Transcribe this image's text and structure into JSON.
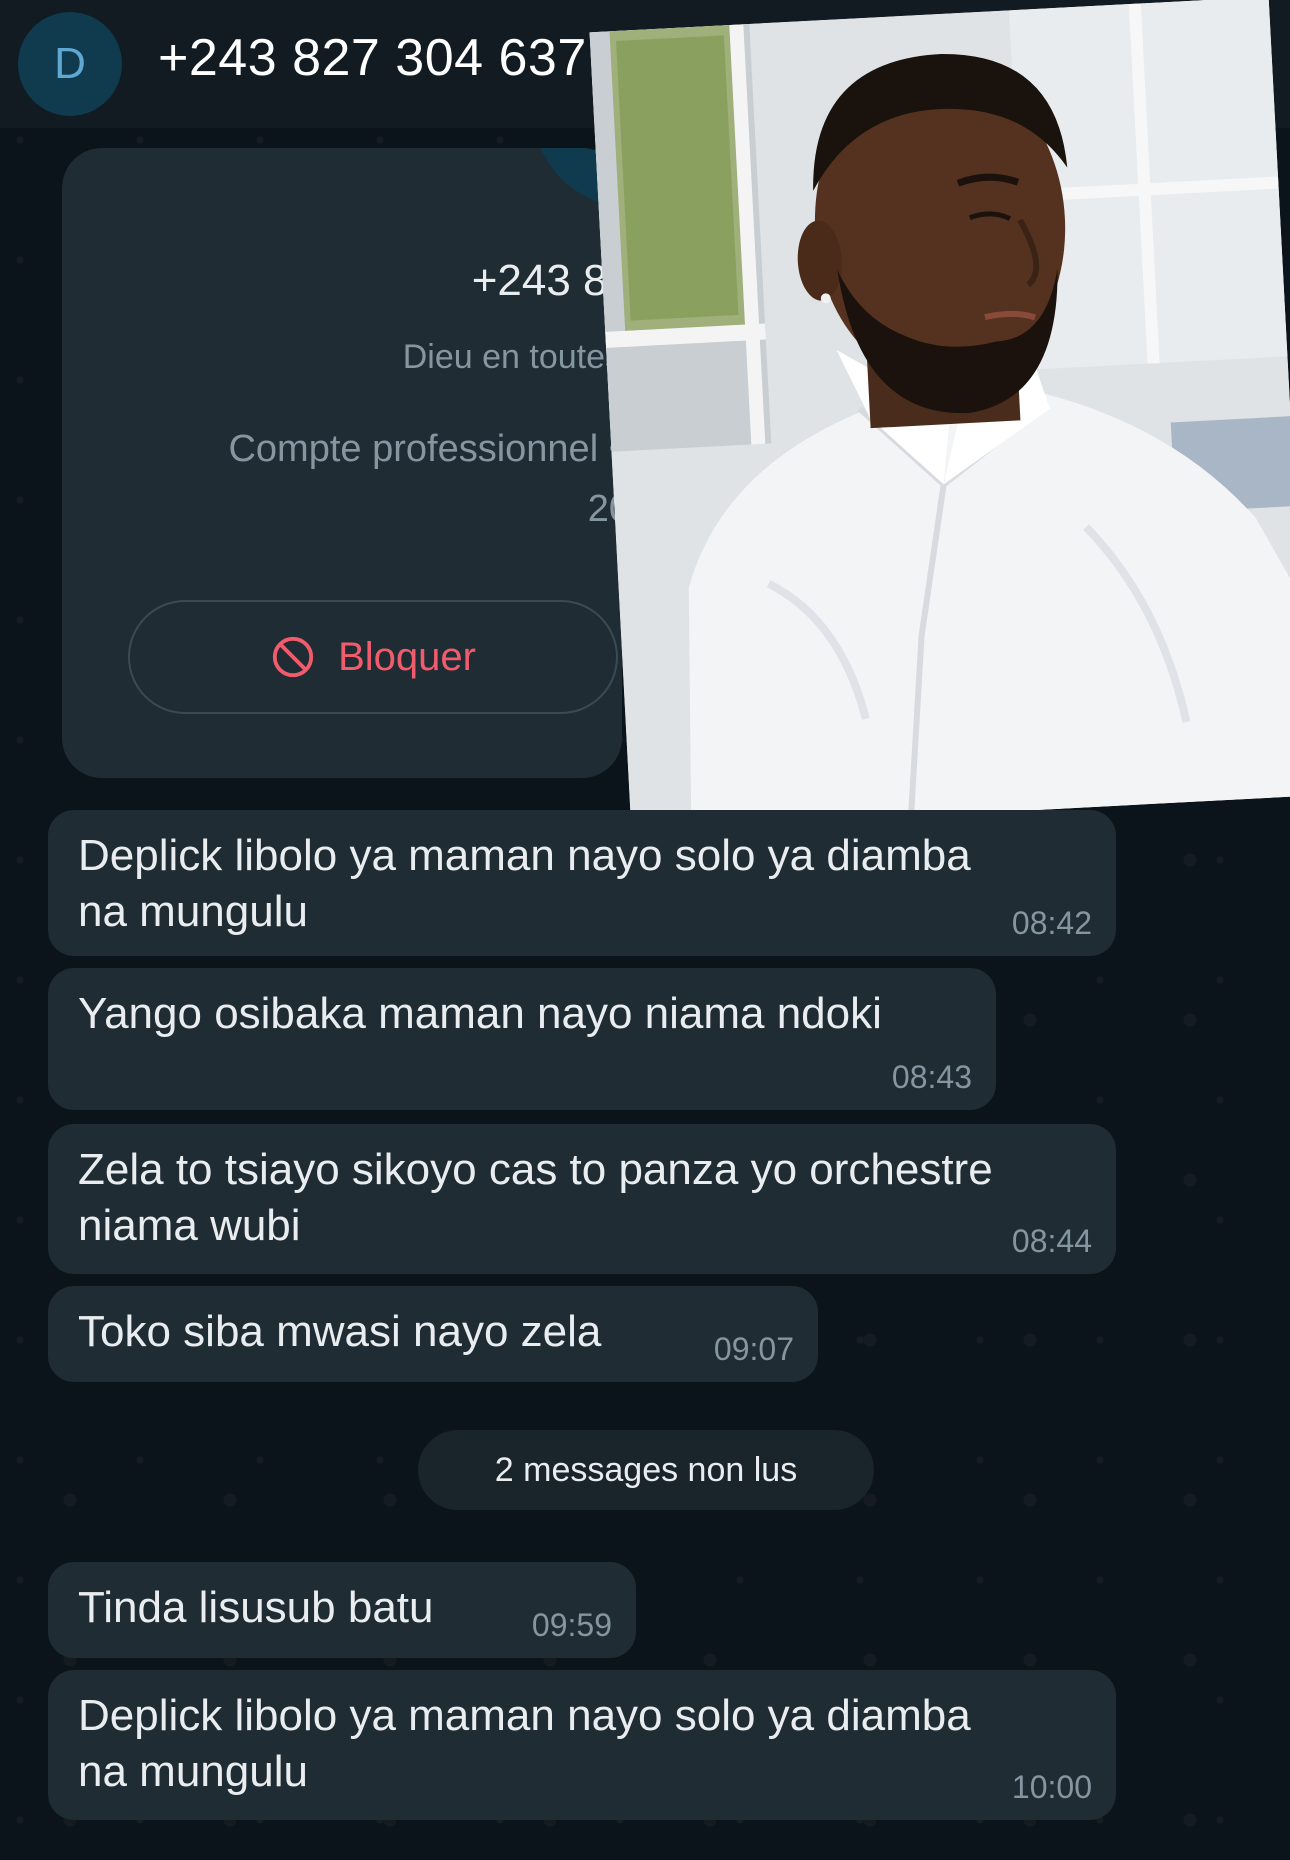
{
  "header": {
    "avatar_letter": "D",
    "title": "+243 827 304 637"
  },
  "info_card": {
    "phone_partial": "+243 82",
    "status_partial": "Dieu en toutes",
    "account_type_partial": "Compte professionnel •",
    "year_partial": "20",
    "block_label": "Bloquer"
  },
  "messages": [
    {
      "text": "Deplick libolo ya maman nayo solo ya diamba na mungulu",
      "time": "08:42"
    },
    {
      "text": "Yango osibaka maman nayo niama ndoki",
      "time": "08:43"
    },
    {
      "text": "Zela to tsiayo sikoyo cas to panza yo orchestre niama wubi",
      "time": "08:44"
    },
    {
      "text": "Toko siba mwasi nayo zela",
      "time": "09:07"
    },
    {
      "text": "Tinda lisusub batu",
      "time": "09:59"
    },
    {
      "text": "Deplick libolo ya maman nayo solo ya diamba na mungulu",
      "time": "10:00"
    }
  ],
  "unread_divider": "2 messages non lus",
  "colors": {
    "background": "#0b141a",
    "bubble": "#1f2c33",
    "header": "#111b21",
    "block_red": "#f15c6d",
    "meta_gray": "#8696a0"
  },
  "icons": {
    "block": "block-icon"
  }
}
